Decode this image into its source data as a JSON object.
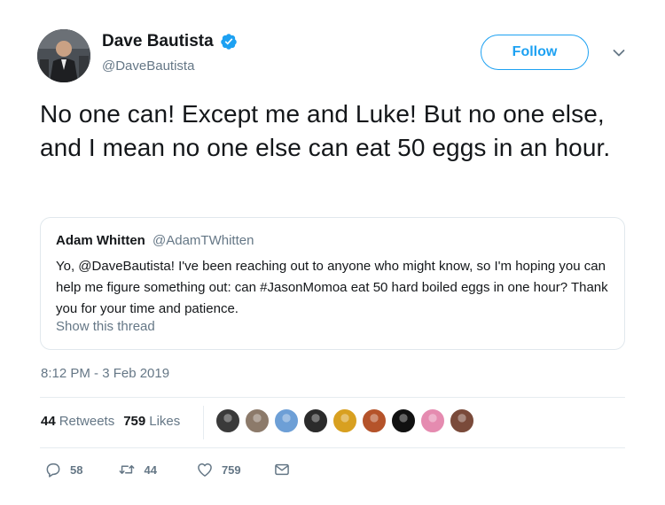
{
  "author": {
    "name": "Dave Bautista",
    "handle": "@DaveBautista",
    "verified": true
  },
  "follow_button": {
    "label": "Follow"
  },
  "tweet": {
    "text": "No one can! Except me and Luke! But no one else, and I mean no one else can eat 50 eggs in an hour.",
    "timestamp": "8:12 PM - 3 Feb 2019"
  },
  "quoted_tweet": {
    "name": "Adam Whitten",
    "handle": "@AdamTWhitten",
    "text": "Yo, @DaveBautista! I've been reaching out to anyone who might know, so I'm hoping you can help me figure something out: can #JasonMomoa eat 50 hard boiled eggs in one hour? Thank you for your time and patience.",
    "show_thread": "Show this thread"
  },
  "stats": {
    "retweets_count": "44",
    "retweets_label": "Retweets",
    "likes_count": "759",
    "likes_label": "Likes"
  },
  "liker_avatars": [
    {
      "name": "liker-avatar-1",
      "color": "#3a3a3a"
    },
    {
      "name": "liker-avatar-2",
      "color": "#8c7a6a"
    },
    {
      "name": "liker-avatar-3",
      "color": "#6d9fd6"
    },
    {
      "name": "liker-avatar-4",
      "color": "#2b2b2b"
    },
    {
      "name": "liker-avatar-5",
      "color": "#d8a020"
    },
    {
      "name": "liker-avatar-6",
      "color": "#b5532a"
    },
    {
      "name": "liker-avatar-7",
      "color": "#111111"
    },
    {
      "name": "liker-avatar-8",
      "color": "#e58bb0"
    },
    {
      "name": "liker-avatar-9",
      "color": "#7a4a3a"
    }
  ],
  "actions": {
    "reply_count": "58",
    "retweet_count": "44",
    "like_count": "759"
  },
  "colors": {
    "accent": "#1da1f2",
    "secondary_text": "#657786",
    "border": "#e1e8ed"
  }
}
